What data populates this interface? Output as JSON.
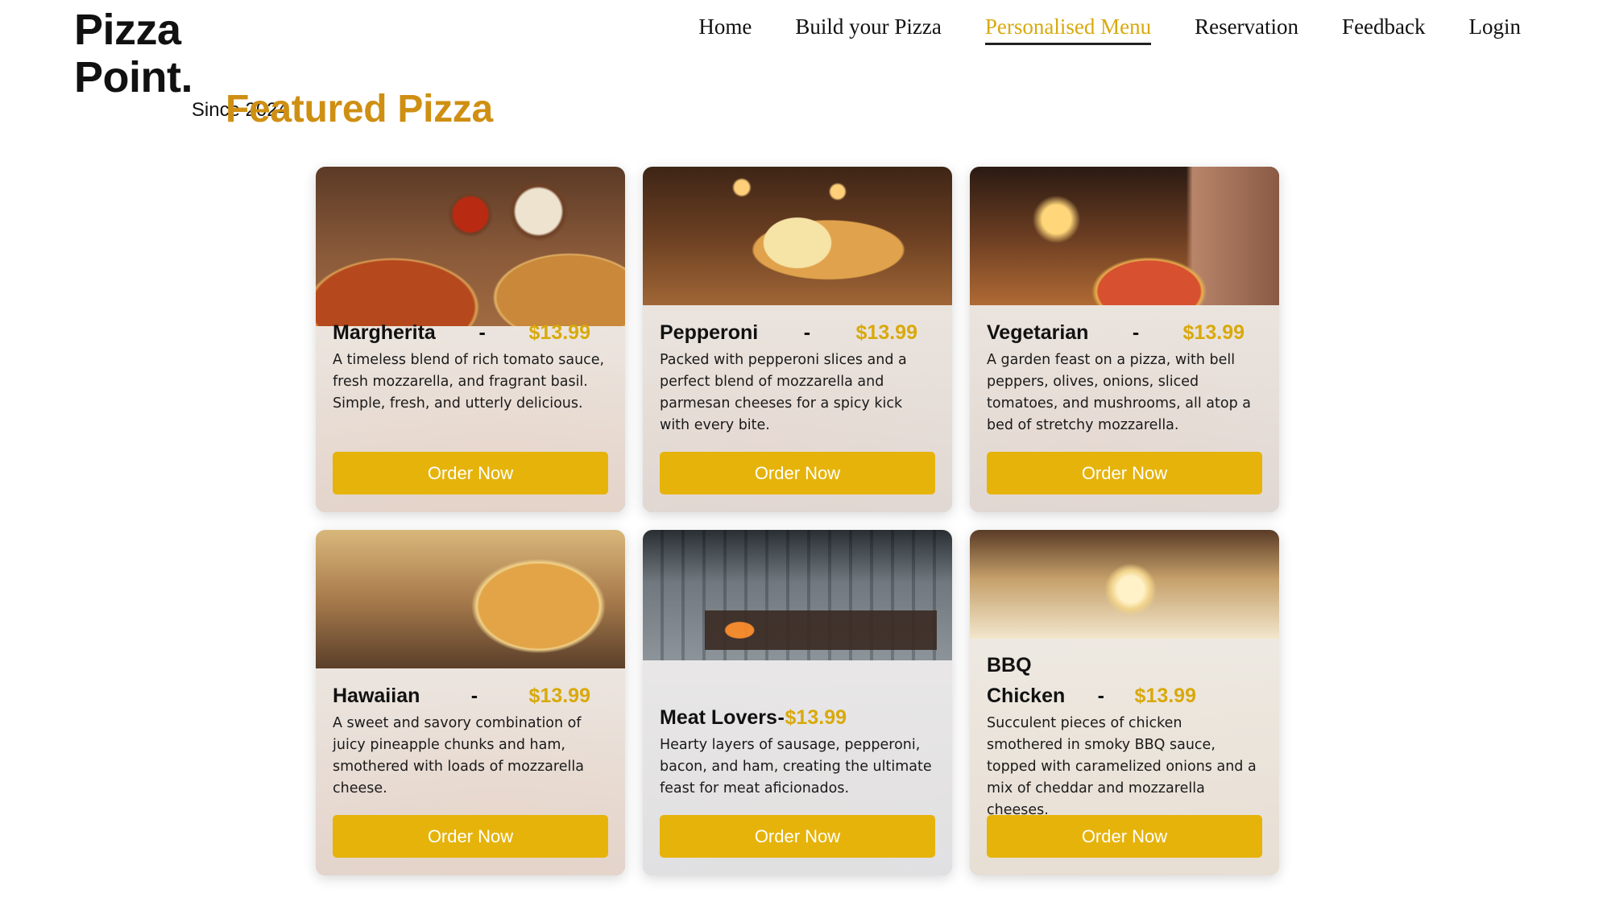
{
  "brand": {
    "name": "Pizza Point.",
    "tagline": "Since 2024"
  },
  "nav": {
    "items": [
      {
        "label": "Home"
      },
      {
        "label": "Build your Pizza"
      },
      {
        "label": "Personalised Menu",
        "active": true
      },
      {
        "label": "Reservation"
      },
      {
        "label": "Feedback"
      },
      {
        "label": "Login"
      }
    ]
  },
  "section": {
    "title": "Featured Pizza"
  },
  "colors": {
    "accent": "#d9a90c",
    "title": "#cf8f12",
    "button": "#e6b30a",
    "button_text": "#ffffff"
  },
  "pizzas": [
    {
      "name": "Margherita",
      "dash": "-",
      "price": "$13.99",
      "description": "A timeless blend of rich tomato sauce, fresh mozzarella, and fragrant basil. Simple, fresh, and utterly delicious.",
      "button": "Order Now"
    },
    {
      "name": "Pepperoni",
      "dash": "-",
      "price": "$13.99",
      "description": "Packed with pepperoni slices and a perfect blend of mozzarella and parmesan cheeses for a spicy kick with every bite.",
      "button": "Order Now"
    },
    {
      "name": "Vegetarian",
      "dash": "-",
      "price": "$13.99",
      "description": "A garden feast on a pizza, with bell peppers, olives, onions, sliced tomatoes, and mushrooms, all atop a bed of stretchy mozzarella.",
      "button": "Order Now"
    },
    {
      "name": "Hawaiian",
      "dash": "-",
      "price": "$13.99",
      "description": "A sweet and savory combination of juicy pineapple chunks and ham, smothered with loads of mozzarella cheese.",
      "button": "Order Now"
    },
    {
      "name": "Meat Lovers",
      "dash": "-",
      "price": "$13.99",
      "description": "Hearty layers of sausage, pepperoni, bacon, and ham, creating the ultimate feast for meat aficionados.",
      "button": "Order Now"
    },
    {
      "name": "BBQ Chicken",
      "dash": "-",
      "price": "$13.99",
      "description": "Succulent pieces of chicken smothered in smoky BBQ sauce, topped with caramelized onions and a mix of cheddar and mozzarella cheeses.",
      "button": "Order Now"
    }
  ]
}
